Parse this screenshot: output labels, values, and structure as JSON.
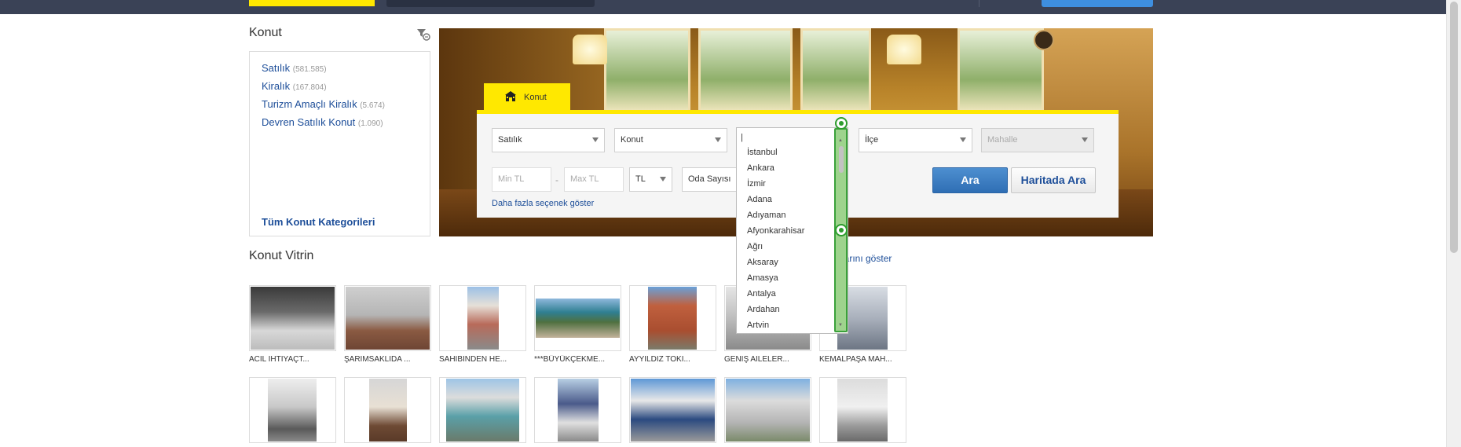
{
  "sidebar": {
    "title": "Konut",
    "filter_icon": "filter-icon",
    "items": [
      {
        "label": "Satılık",
        "count": "(581.585)"
      },
      {
        "label": "Kiralık",
        "count": "(167.804)"
      },
      {
        "label": "Turizm Amaçlı Kiralık",
        "count": "(5.674)"
      },
      {
        "label": "Devren Satılık Konut",
        "count": "(1.090)"
      }
    ],
    "all_categories": "Tüm Konut Kategorileri"
  },
  "search": {
    "tab_label": "Konut",
    "tab_icon": "house-icon",
    "type_select": "Satılık",
    "category_select": "Konut",
    "city_input": "",
    "district_select": "İlçe",
    "neighborhood_select": "Mahalle",
    "min_price_placeholder": "Min TL",
    "dash": "-",
    "max_price_placeholder": "Max TL",
    "currency_select": "TL",
    "rooms_select": "Oda Sayısı",
    "more_options": "Daha fazla seçenek göster",
    "search_button": "Ara",
    "map_search_button": "Haritada Ara"
  },
  "city_dropdown": {
    "options": [
      "İstanbul",
      "Ankara",
      "İzmir",
      "Adana",
      "Adıyaman",
      "Afyonkarahisar",
      "Ağrı",
      "Aksaray",
      "Amasya",
      "Antalya",
      "Ardahan",
      "Artvin"
    ]
  },
  "vitrin": {
    "title": "Konut Vitrin",
    "show_all_link": "larını göster",
    "row1": [
      {
        "caption": "ACİL İHTİYAÇT..."
      },
      {
        "caption": "ŞARIMSAKLIDA ..."
      },
      {
        "caption": "SAHİBİNDEN HE..."
      },
      {
        "caption": "***BÜYÜKÇEKME..."
      },
      {
        "caption": "AYYILDIZ TOKİ..."
      },
      {
        "caption": "GENİŞ AİLELER..."
      },
      {
        "caption": "KEMALPAŞA MAH..."
      }
    ]
  },
  "colors": {
    "accent_yellow": "#ffe800",
    "link_blue": "#1d4e99",
    "topbar": "#3a4256",
    "button_blue": "#3479c4"
  }
}
